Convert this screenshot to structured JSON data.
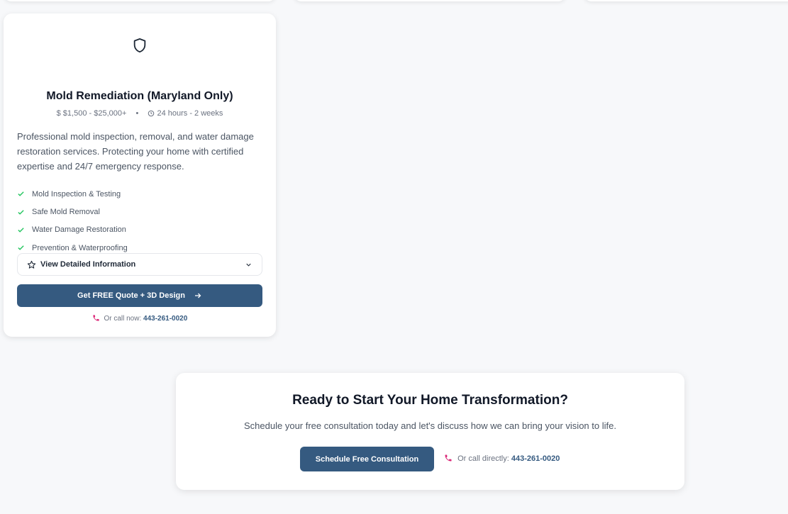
{
  "service_card": {
    "icon": "shield-icon",
    "title": "Mold Remediation (Maryland Only)",
    "price": "$1,500 - $25,000+",
    "separator": "•",
    "duration": "24 hours - 2 weeks",
    "description": "Professional mold inspection, removal, and water damage restoration services. Protecting your home with certified expertise and 24/7 emergency response.",
    "features": [
      "Mold Inspection & Testing",
      "Safe Mold Removal",
      "Water Damage Restoration",
      "Prevention & Waterproofing"
    ],
    "details_label": "View Detailed Information",
    "quote_label": "Get FREE Quote + 3D Design",
    "call_prefix": "Or call now:",
    "phone": "443-261-0020"
  },
  "cta": {
    "title": "Ready to Start Your Home Transformation?",
    "subtitle": "Schedule your free consultation today and let's discuss how we can bring your vision to life.",
    "button_label": "Schedule Free Consultation",
    "call_prefix": "Or call directly:",
    "phone": "443-261-0020"
  },
  "colors": {
    "primary": "#355a80",
    "check": "#22c55e",
    "phone_icon": "#db2777",
    "background": "#f7f8fa"
  }
}
